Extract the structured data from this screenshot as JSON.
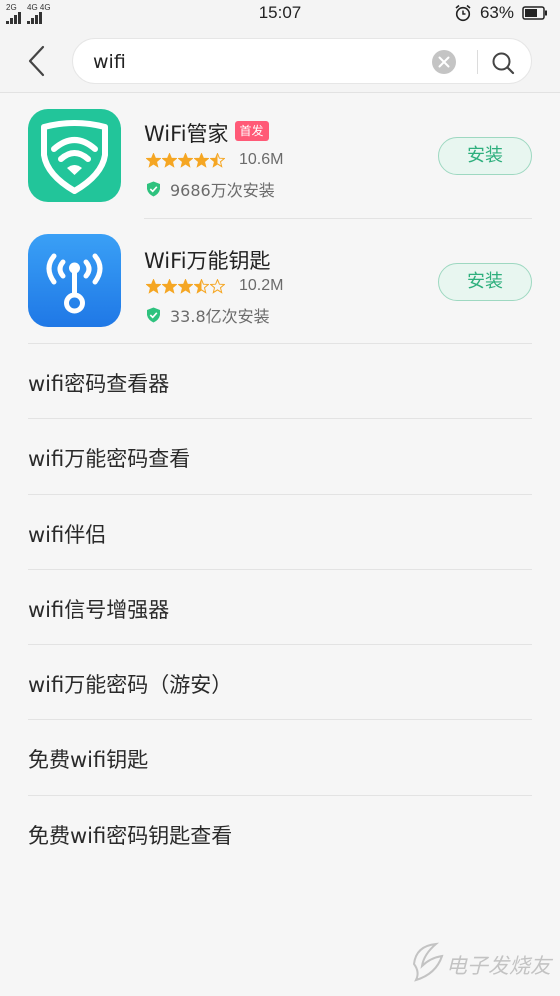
{
  "status_bar": {
    "sim1_label": "2G",
    "sim2_label": "4G 4G",
    "time": "15:07",
    "battery": "63%",
    "icons": [
      "signal-icon",
      "alarm-icon",
      "battery-icon"
    ]
  },
  "search": {
    "value": "wifi",
    "icons": [
      "back-arrow-icon",
      "clear-icon",
      "search-icon"
    ]
  },
  "apps": [
    {
      "name": "WiFi管家",
      "badge": "首发",
      "rating": 4.5,
      "size": "10.6M",
      "installs": "9686万次安装",
      "button": "安装",
      "icon": "wifi-manager-icon",
      "icon_color": "#22c59a"
    },
    {
      "name": "WiFi万能钥匙",
      "badge": "",
      "rating": 3.5,
      "size": "10.2M",
      "installs": "33.8亿次安装",
      "button": "安装",
      "icon": "wifi-master-key-icon",
      "icon_color": "#2d8cf0"
    }
  ],
  "suggestions": [
    "wifi密码查看器",
    "wifi万能密码查看",
    "wifi伴侣",
    "wifi信号增强器",
    "wifi万能密码（游安）",
    "免费wifi钥匙",
    "免费wifi密码钥匙查看"
  ],
  "colors": {
    "star": "#f5a623",
    "install_text": "#2eaf7d",
    "badge": "#ff5a77",
    "shield": "#2ec27e"
  },
  "watermark": "电子发烧友"
}
